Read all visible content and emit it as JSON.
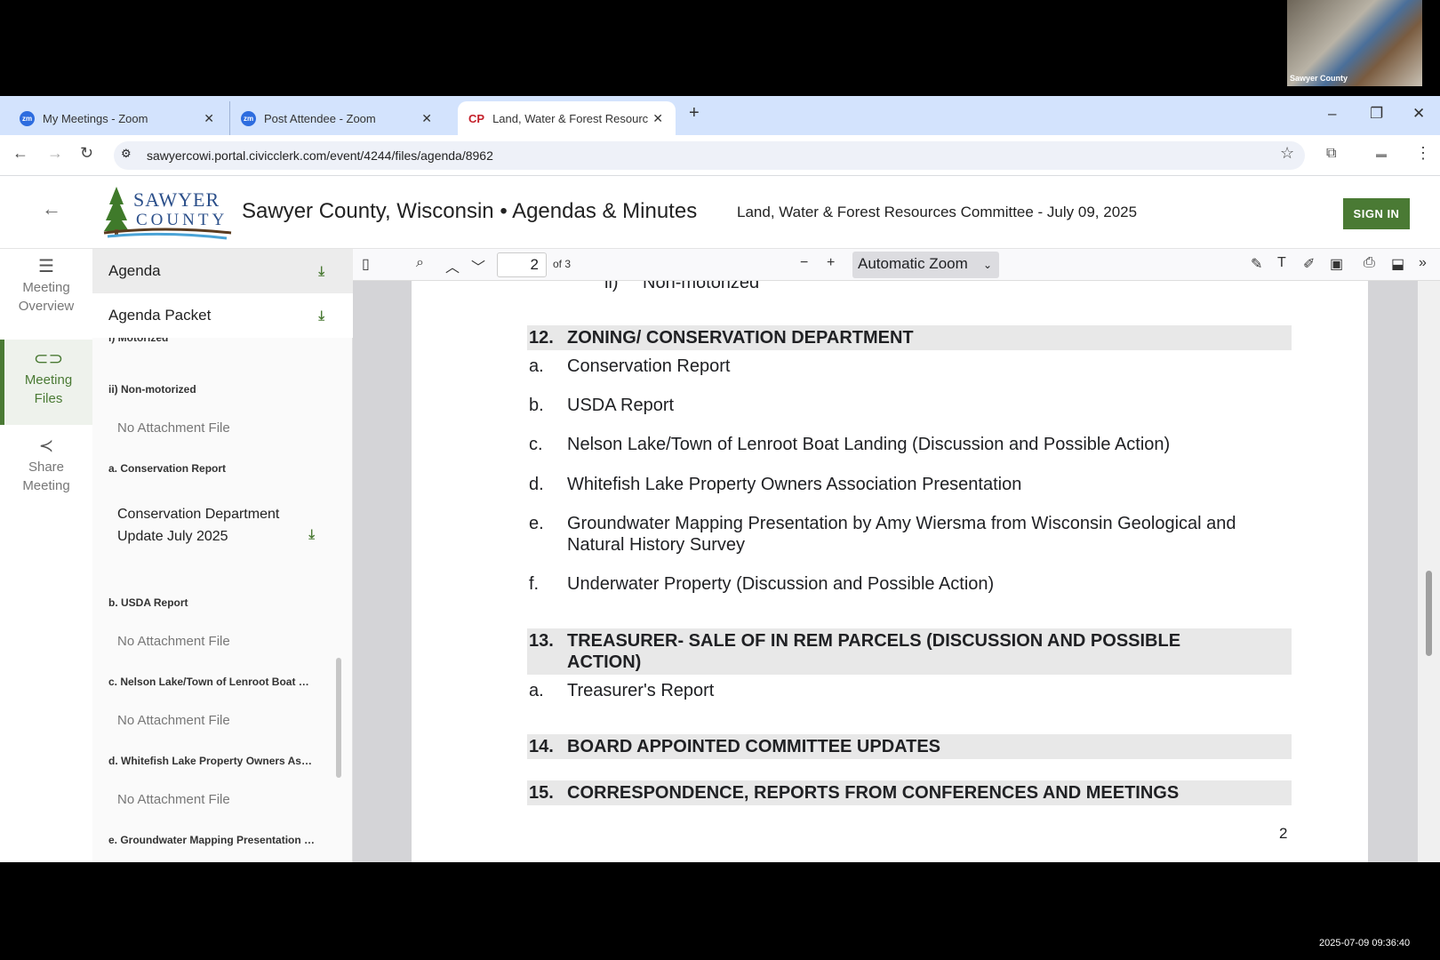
{
  "video": {
    "label": "Sawyer County"
  },
  "browser": {
    "tabs": [
      {
        "title": "My Meetings - Zoom",
        "icon": "zoom-icon"
      },
      {
        "title": "Post Attendee - Zoom",
        "icon": "zoom-icon"
      },
      {
        "title": "Land, Water & Forest Resource",
        "icon": "civicclerk-icon",
        "active": true
      }
    ],
    "url": "sawyercowi.portal.civicclerk.com/event/4244/files/agenda/8962"
  },
  "header": {
    "logo_top": "SAWYER",
    "logo_bottom": "COUNTY",
    "title": "Sawyer County, Wisconsin • Agendas & Minutes",
    "subtitle": "Land, Water & Forest Resources Committee - July 09, 2025",
    "sign_in": "SIGN IN",
    "accent": "#4a7a34"
  },
  "nav": [
    {
      "line1": "Meeting",
      "line2": "Overview"
    },
    {
      "line1": "Meeting",
      "line2": "Files",
      "active": true
    },
    {
      "line1": "Share",
      "line2": "Meeting"
    }
  ],
  "files": {
    "agenda": "Agenda",
    "packet": "Agenda Packet",
    "items": [
      {
        "type": "label",
        "text": "i) Motorized"
      },
      {
        "type": "label",
        "text": "ii) Non-motorized"
      },
      {
        "type": "none",
        "text": "No Attachment File"
      },
      {
        "type": "label",
        "text": "a. Conservation Report"
      },
      {
        "type": "file",
        "text": "Conservation Department Update July 2025"
      },
      {
        "type": "label",
        "text": "b. USDA Report"
      },
      {
        "type": "none",
        "text": "No Attachment File"
      },
      {
        "type": "label",
        "text": "c. Nelson Lake/Town of Lenroot Boat …"
      },
      {
        "type": "none",
        "text": "No Attachment File"
      },
      {
        "type": "label",
        "text": "d. Whitefish Lake Property Owners As…"
      },
      {
        "type": "none",
        "text": "No Attachment File"
      },
      {
        "type": "label",
        "text": "e. Groundwater Mapping Presentation …"
      }
    ]
  },
  "pdf": {
    "page": "2",
    "of": "of 3",
    "zoom": "Automatic Zoom",
    "page_number": "2",
    "top_item": {
      "l": "ii)",
      "t": "Non-motorized"
    },
    "h12": {
      "n": "12.",
      "t": "ZONING/ CONSERVATION DEPARTMENT"
    },
    "items12": [
      {
        "l": "a.",
        "t": "Conservation Report"
      },
      {
        "l": "b.",
        "t": "USDA Report"
      },
      {
        "l": "c.",
        "t": "Nelson Lake/Town of Lenroot Boat Landing (Discussion and Possible Action)"
      },
      {
        "l": "d.",
        "t": "Whitefish Lake Property Owners Association Presentation"
      },
      {
        "l": "e.",
        "t": "Groundwater Mapping Presentation by Amy Wiersma from Wisconsin Geological and Natural History Survey"
      },
      {
        "l": "f.",
        "t": "Underwater Property (Discussion and Possible Action)"
      }
    ],
    "h13": {
      "n": "13.",
      "t": "TREASURER- SALE OF IN REM PARCELS (DISCUSSION AND POSSIBLE ACTION)"
    },
    "items13": [
      {
        "l": "a.",
        "t": "Treasurer's Report"
      }
    ],
    "h14": {
      "n": "14.",
      "t": "BOARD APPOINTED COMMITTEE UPDATES"
    },
    "h15": {
      "n": "15.",
      "t": "CORRESPONDENCE, REPORTS FROM CONFERENCES AND MEETINGS"
    }
  },
  "timestamp": "2025-07-09 09:36:40"
}
